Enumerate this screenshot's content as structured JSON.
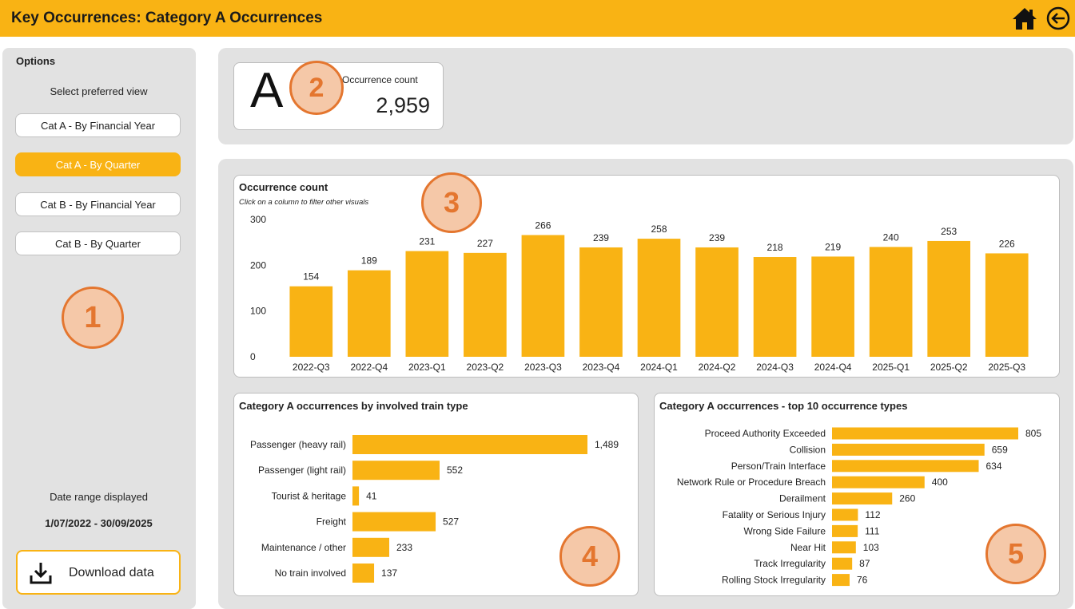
{
  "header": {
    "title": "Key Occurrences: Category A Occurrences",
    "home_icon": "home-icon",
    "back_icon": "back-arrow-icon"
  },
  "sidebar": {
    "heading": "Options",
    "view_label": "Select preferred view",
    "views": [
      {
        "label": "Cat A - By Financial Year",
        "active": false
      },
      {
        "label": "Cat A - By Quarter",
        "active": true
      },
      {
        "label": "Cat B - By Financial Year",
        "active": false
      },
      {
        "label": "Cat B - By Quarter",
        "active": false
      }
    ],
    "date_label": "Date range displayed",
    "date_value": "1/07/2022 - 30/09/2025",
    "download_label": "Download data",
    "download_icon": "download-icon"
  },
  "kpi": {
    "letter": "A",
    "label": "Occurrence count",
    "value": "2,959"
  },
  "badges": [
    "1",
    "2",
    "3",
    "4",
    "5"
  ],
  "colors": {
    "accent": "#f9b314",
    "panel": "#e2e2e2",
    "badge_border": "#e4762f",
    "badge_fill": "#f5c8a8"
  },
  "chart_data": [
    {
      "type": "bar",
      "title": "Occurrence count",
      "subtitle": "Click on a column to filter other visuals",
      "categories": [
        "2022-Q3",
        "2022-Q4",
        "2023-Q1",
        "2023-Q2",
        "2023-Q3",
        "2023-Q4",
        "2024-Q1",
        "2024-Q2",
        "2024-Q3",
        "2024-Q4",
        "2025-Q1",
        "2025-Q2",
        "2025-Q3"
      ],
      "values": [
        154,
        189,
        231,
        227,
        266,
        239,
        258,
        239,
        218,
        219,
        240,
        253,
        226
      ],
      "ylim": [
        0,
        300
      ],
      "yticks": [
        0,
        100,
        200,
        300
      ],
      "xlabel": "",
      "ylabel": ""
    },
    {
      "type": "bar",
      "orientation": "horizontal",
      "title": "Category A occurrences by involved train type",
      "categories": [
        "Passenger (heavy rail)",
        "Passenger (light rail)",
        "Tourist & heritage",
        "Freight",
        "Maintenance / other",
        "No train involved"
      ],
      "values": [
        1489,
        552,
        41,
        527,
        233,
        137
      ],
      "value_labels": [
        "1,489",
        "552",
        "41",
        "527",
        "233",
        "137"
      ]
    },
    {
      "type": "bar",
      "orientation": "horizontal",
      "title": "Category A occurrences - top 10 occurrence types",
      "categories": [
        "Proceed Authority Exceeded",
        "Collision",
        "Person/Train Interface",
        "Network Rule or Procedure Breach",
        "Derailment",
        "Fatality or Serious Injury",
        "Wrong Side Failure",
        "Near Hit",
        "Track Irregularity",
        "Rolling Stock Irregularity"
      ],
      "values": [
        805,
        659,
        634,
        400,
        260,
        112,
        111,
        103,
        87,
        76
      ],
      "value_labels": [
        "805",
        "659",
        "634",
        "400",
        "260",
        "112",
        "111",
        "103",
        "87",
        "76"
      ]
    }
  ]
}
